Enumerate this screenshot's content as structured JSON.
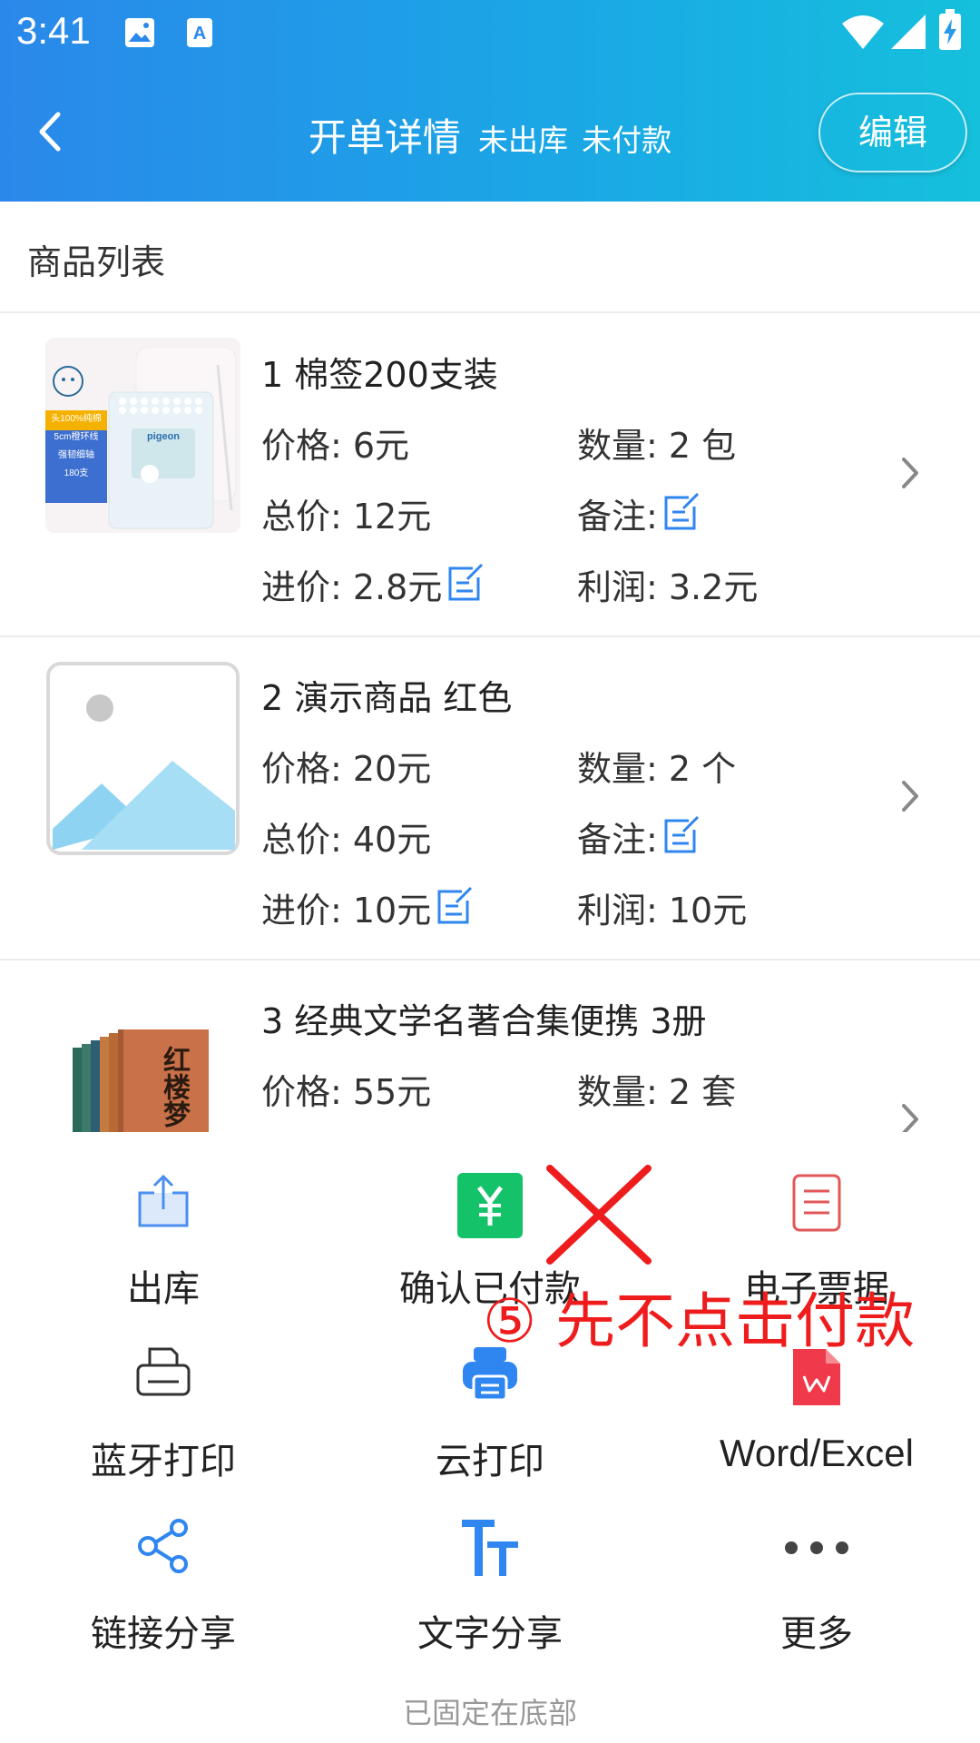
{
  "status_bar": {
    "time": "3:41"
  },
  "header": {
    "title": "开单详情",
    "status_stock": "未出库",
    "status_payment": "未付款",
    "edit_label": "编辑"
  },
  "section_title": "商品列表",
  "products": [
    {
      "name": "1 棉签200支装",
      "price": "价格: 6元",
      "quantity": "数量: 2 包",
      "total": "总价: 12元",
      "note": "备注:",
      "cost": "进价: 2.8元",
      "profit": "利润: 3.2元",
      "box_text": [
        "头100%纯棉",
        "5cm橙环线",
        "强韧细轴",
        "180支"
      ]
    },
    {
      "name": "2 演示商品 红色",
      "price": "价格: 20元",
      "quantity": "数量: 2 个",
      "total": "总价: 40元",
      "note": "备注:",
      "cost": "进价: 10元",
      "profit": "利润: 10元"
    },
    {
      "name": "3 经典文学名著合集便携 3册",
      "price": "价格: 55元",
      "quantity": "数量: 2 套",
      "book_title": "红楼梦"
    }
  ],
  "actions": [
    {
      "label": "出库",
      "icon": "share-upload-icon"
    },
    {
      "label": "确认已付款",
      "icon": "yuan-icon"
    },
    {
      "label": "电子票据",
      "icon": "document-icon"
    },
    {
      "label": "蓝牙打印",
      "icon": "printer-outline-icon"
    },
    {
      "label": "云打印",
      "icon": "printer-filled-icon"
    },
    {
      "label": "Word/Excel",
      "icon": "wps-icon"
    },
    {
      "label": "链接分享",
      "icon": "share-nodes-icon"
    },
    {
      "label": "文字分享",
      "icon": "text-size-icon"
    },
    {
      "label": "更多",
      "icon": "more-dots-icon"
    }
  ],
  "fixed_note": "已固定在底部",
  "annotation": {
    "text": "⑤ 先不点击付款"
  },
  "colors": {
    "header_start": "#2a88ea",
    "header_end": "#15c0dc",
    "accent_blue": "#2f86f0",
    "green": "#14c26a",
    "red": "#ee1c1c"
  }
}
